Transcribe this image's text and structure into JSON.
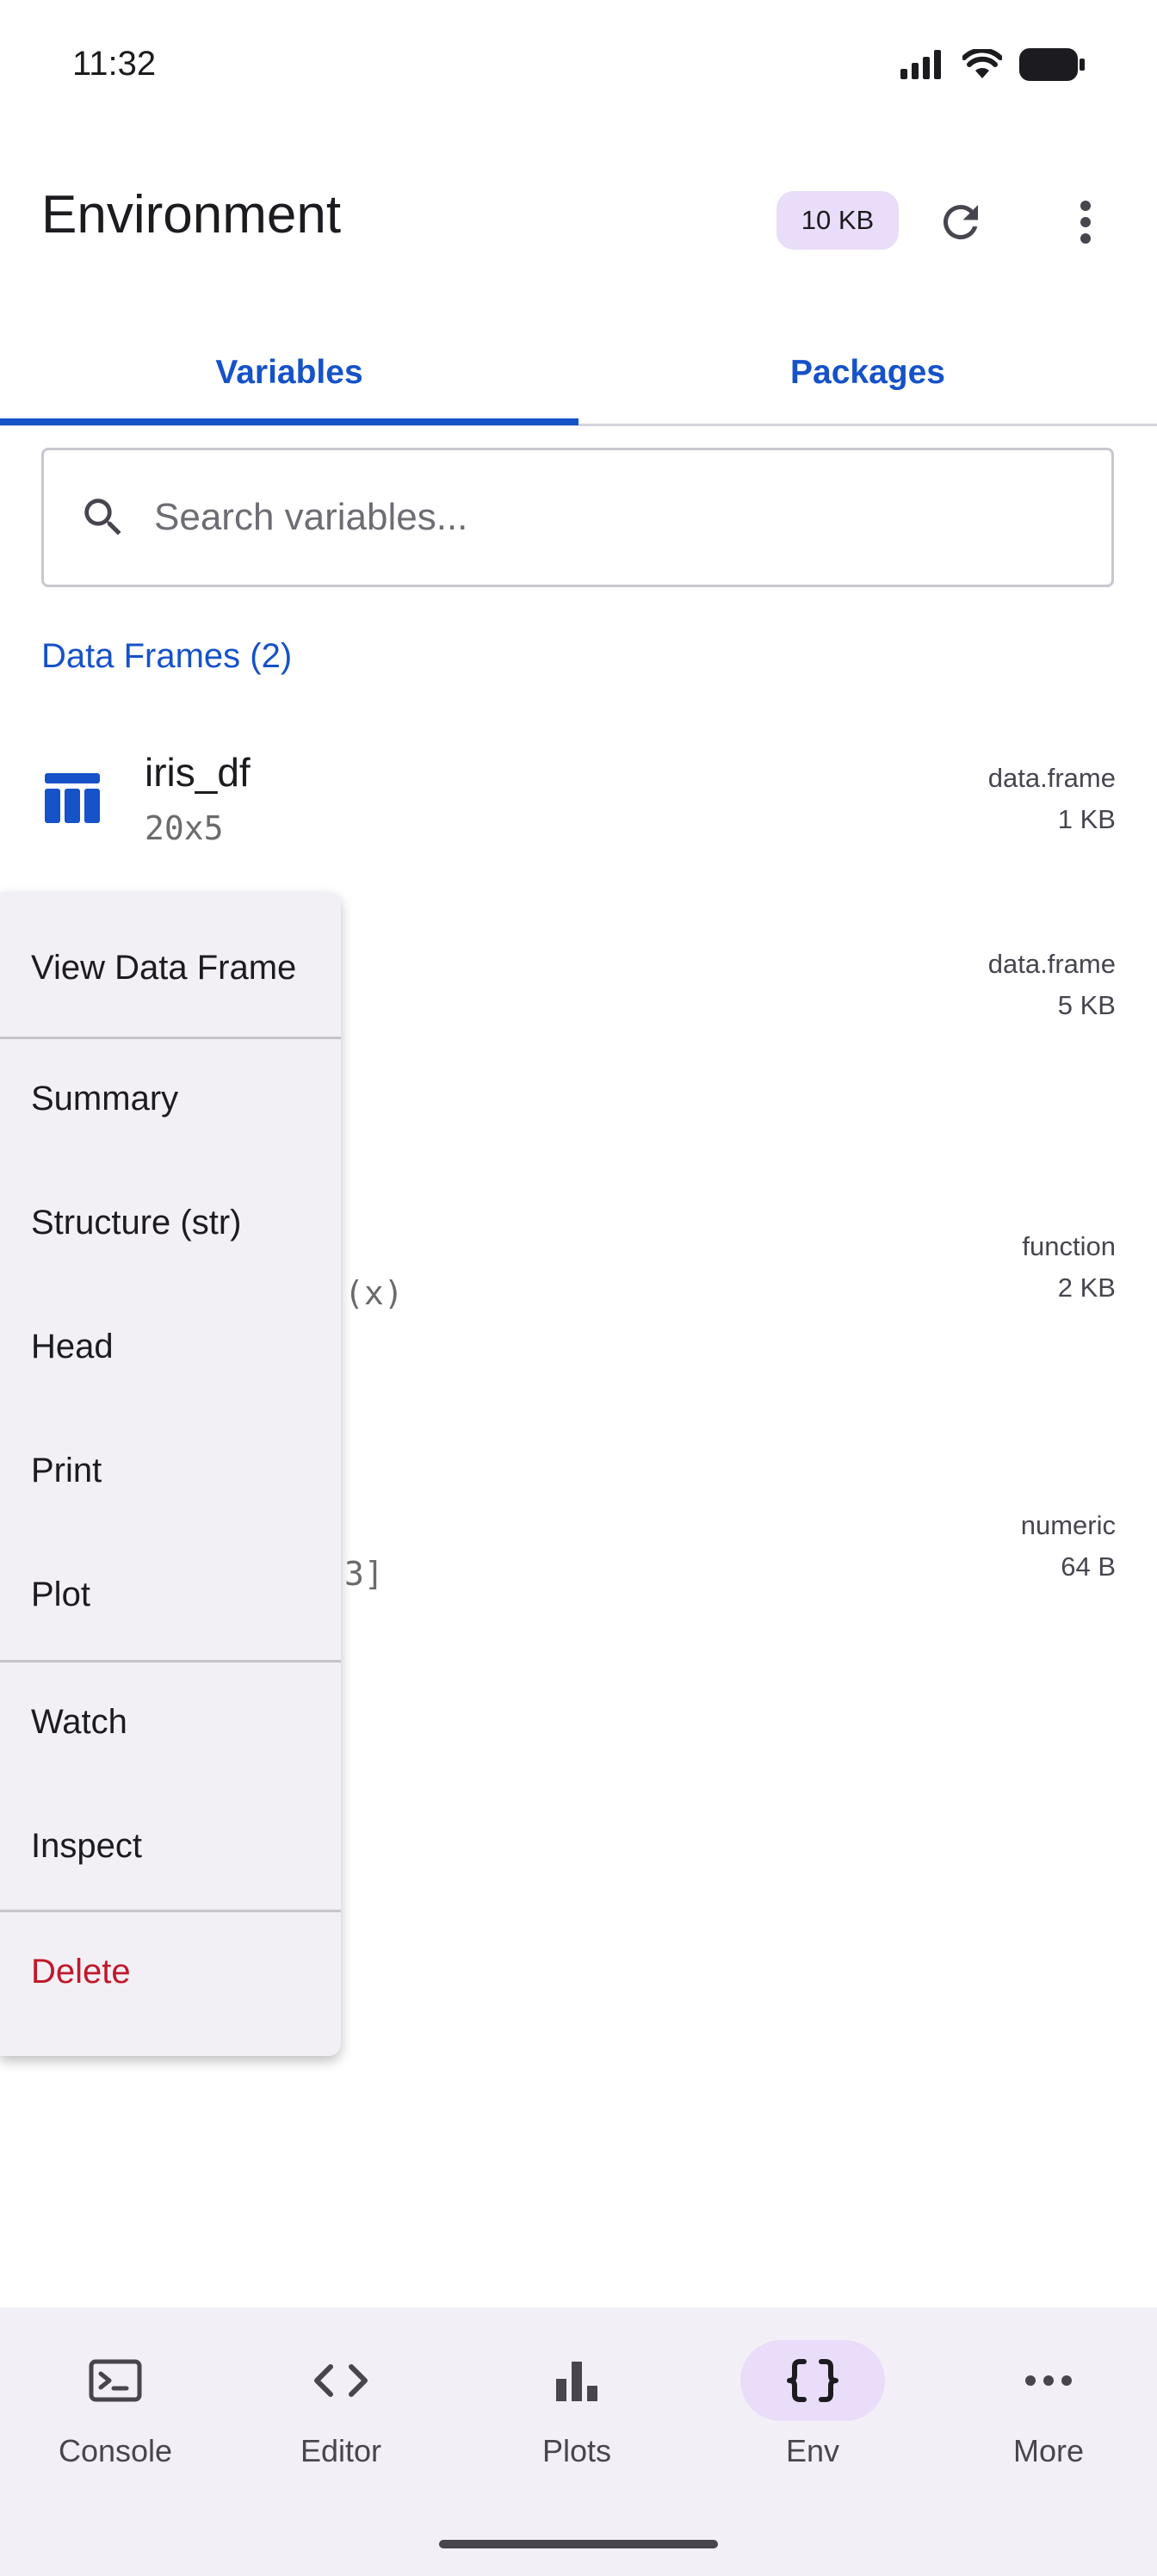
{
  "status_bar": {
    "time": "11:32"
  },
  "header": {
    "title": "Environment",
    "memory_chip": "10 KB"
  },
  "tabs": [
    {
      "label": "Variables",
      "active": true
    },
    {
      "label": "Packages",
      "active": false
    }
  ],
  "search": {
    "placeholder": "Search variables..."
  },
  "section": {
    "label": "Data Frames (2)"
  },
  "variables": [
    {
      "name": "iris_df",
      "dims": "20x5",
      "type": "data.frame",
      "size": "1 KB"
    },
    {
      "name": "",
      "dims": "",
      "type": "data.frame",
      "size": "5 KB"
    },
    {
      "name": "",
      "dims": "(x)",
      "type": "function",
      "size": "2 KB"
    },
    {
      "name": "",
      "dims": "3]",
      "type": "numeric",
      "size": "64 B"
    }
  ],
  "context_menu": {
    "items": [
      {
        "label": "View Data Frame"
      },
      {
        "label": "Summary"
      },
      {
        "label": "Structure (str)"
      },
      {
        "label": "Head"
      },
      {
        "label": "Print"
      },
      {
        "label": "Plot"
      },
      {
        "label": "Watch"
      },
      {
        "label": "Inspect"
      },
      {
        "label": "Delete"
      }
    ]
  },
  "bottom_nav": [
    {
      "label": "Console",
      "icon": "terminal-icon",
      "active": false
    },
    {
      "label": "Editor",
      "icon": "code-icon",
      "active": false
    },
    {
      "label": "Plots",
      "icon": "bar-chart-icon",
      "active": false
    },
    {
      "label": "Env",
      "icon": "braces-icon",
      "active": true
    },
    {
      "label": "More",
      "icon": "more-horiz-icon",
      "active": false
    }
  ],
  "colors": {
    "accent": "#1652c8",
    "danger": "#c0182b",
    "chip": "#e9ddf9"
  }
}
